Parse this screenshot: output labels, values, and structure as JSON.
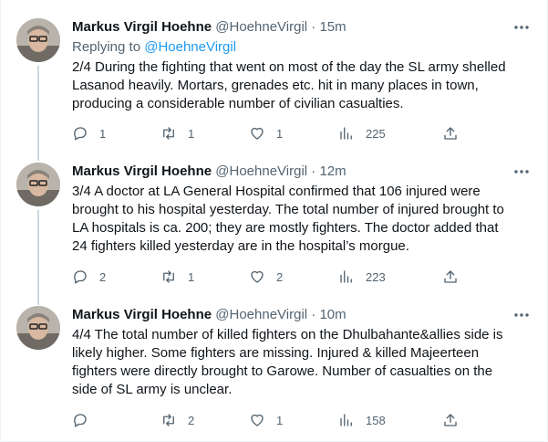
{
  "tweets": [
    {
      "name": "Markus Virgil Hoehne",
      "handle": "@HoehneVirgil",
      "time": "15m",
      "replying_label": "Replying to",
      "replying_mention": "@HoehneVirgil",
      "lines": [
        "2/4 During the fighting that went on most of the day the SL army shelled",
        "Lasanod heavily. Mortars, grenades etc. hit in many places in town,",
        "producing a considerable number of civilian casualties."
      ],
      "replies": "1",
      "retweets": "1",
      "likes": "1",
      "views": "225"
    },
    {
      "name": "Markus Virgil Hoehne",
      "handle": "@HoehneVirgil",
      "time": "12m",
      "lines": [
        "3/4 A doctor at LA General Hospital confirmed that 106 injured were",
        "brought to his hospital yesterday. The total number of injured brought to",
        "LA hospitals is ca. 200; they are mostly fighters. The doctor added that",
        "24 fighters killed yesterday are in the hospital’s morgue."
      ],
      "replies": "2",
      "retweets": "1",
      "likes": "2",
      "views": "223"
    },
    {
      "name": "Markus Virgil Hoehne",
      "handle": "@HoehneVirgil",
      "time": "10m",
      "lines": [
        "4/4 The total number of killed fighters on the Dhulbahante&allies side is",
        "likely higher. Some fighters are missing. Injured & killed Majeerteen",
        "fighters were directly brought to Garowe. Number of casualties on the",
        "side of SL army is unclear."
      ],
      "replies": "",
      "retweets": "2",
      "likes": "1",
      "views": "158"
    }
  ],
  "separator": "·",
  "more_symbol": "•••",
  "colors": {
    "text": "#0f1419",
    "secondary": "#536471",
    "accent": "#1d9bf0",
    "thread_line": "#cfd9de"
  },
  "icons": [
    "reply-icon",
    "retweet-icon",
    "like-icon",
    "views-icon",
    "share-icon",
    "more-icon"
  ]
}
